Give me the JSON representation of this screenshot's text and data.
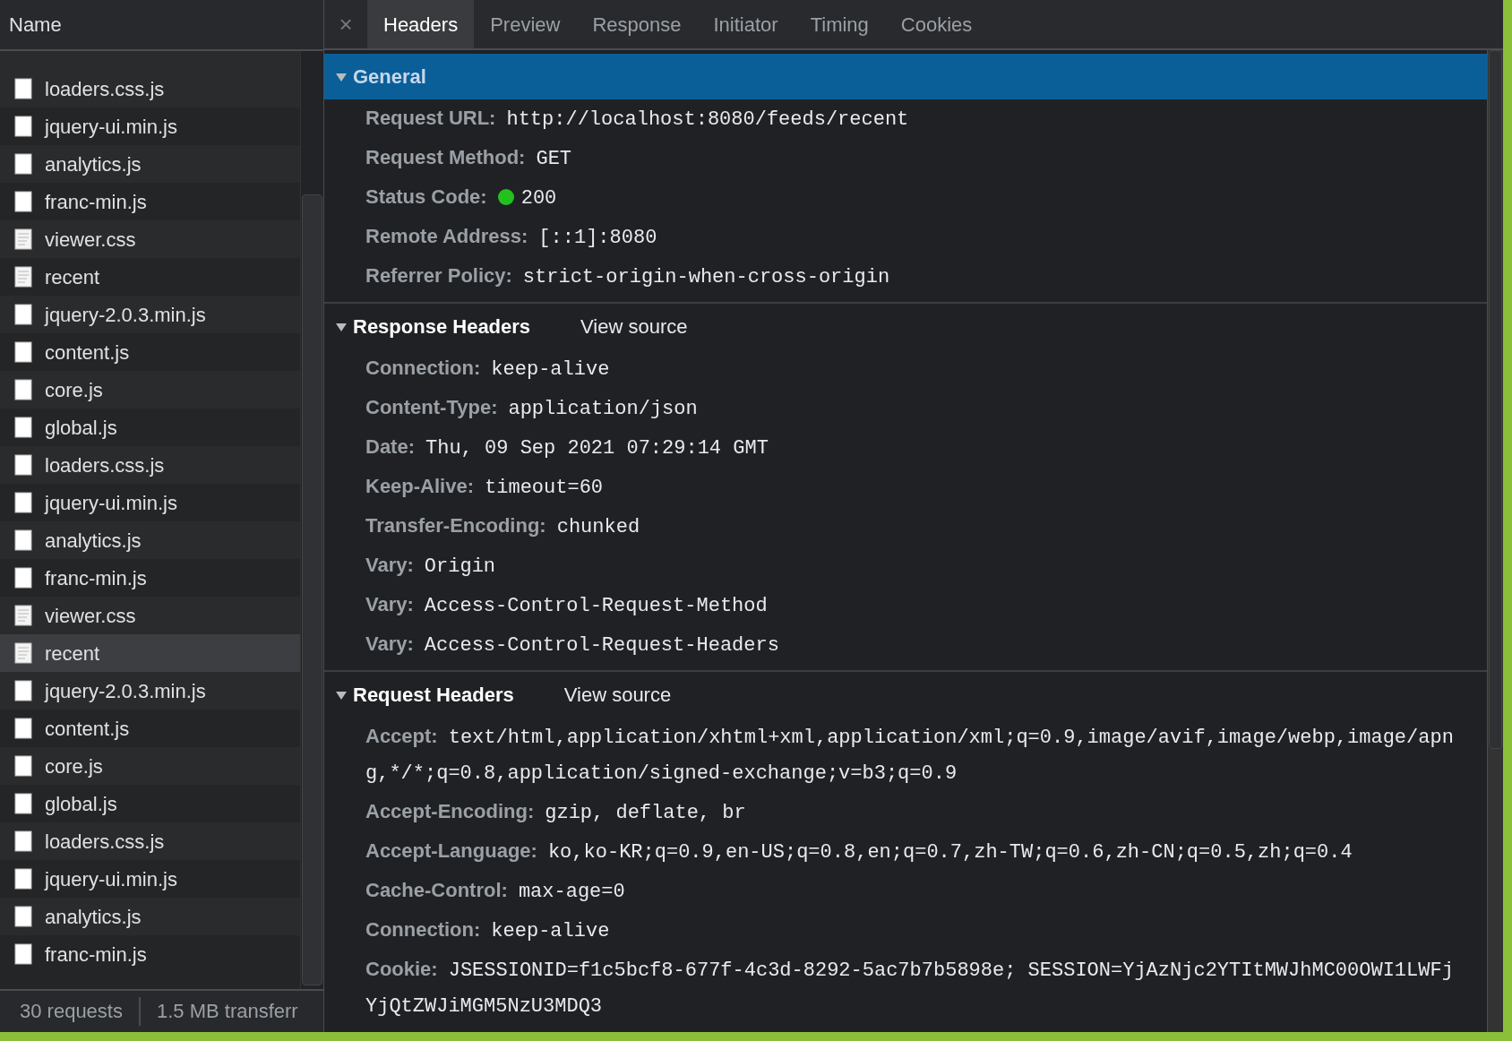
{
  "request_list": {
    "column": "Name",
    "rows": [
      {
        "name": "loaders.css.js",
        "kind": "script",
        "selected": false
      },
      {
        "name": "jquery-ui.min.js",
        "kind": "script",
        "selected": false
      },
      {
        "name": "analytics.js",
        "kind": "script",
        "selected": false
      },
      {
        "name": "franc-min.js",
        "kind": "script",
        "selected": false
      },
      {
        "name": "viewer.css",
        "kind": "text",
        "selected": false
      },
      {
        "name": "recent",
        "kind": "text",
        "selected": false
      },
      {
        "name": "jquery-2.0.3.min.js",
        "kind": "script",
        "selected": false
      },
      {
        "name": "content.js",
        "kind": "script",
        "selected": false
      },
      {
        "name": "core.js",
        "kind": "script",
        "selected": false
      },
      {
        "name": "global.js",
        "kind": "script",
        "selected": false
      },
      {
        "name": "loaders.css.js",
        "kind": "script",
        "selected": false
      },
      {
        "name": "jquery-ui.min.js",
        "kind": "script",
        "selected": false
      },
      {
        "name": "analytics.js",
        "kind": "script",
        "selected": false
      },
      {
        "name": "franc-min.js",
        "kind": "script",
        "selected": false
      },
      {
        "name": "viewer.css",
        "kind": "text",
        "selected": false
      },
      {
        "name": "recent",
        "kind": "text",
        "selected": true
      },
      {
        "name": "jquery-2.0.3.min.js",
        "kind": "script",
        "selected": false
      },
      {
        "name": "content.js",
        "kind": "script",
        "selected": false
      },
      {
        "name": "core.js",
        "kind": "script",
        "selected": false
      },
      {
        "name": "global.js",
        "kind": "script",
        "selected": false
      },
      {
        "name": "loaders.css.js",
        "kind": "script",
        "selected": false
      },
      {
        "name": "jquery-ui.min.js",
        "kind": "script",
        "selected": false
      },
      {
        "name": "analytics.js",
        "kind": "script",
        "selected": false
      },
      {
        "name": "franc-min.js",
        "kind": "script",
        "selected": false
      }
    ]
  },
  "status_bar": [
    "30 requests",
    "1.5 MB transferr"
  ],
  "close_glyph": "×",
  "tabs": [
    {
      "label": "Headers",
      "selected": true
    },
    {
      "label": "Preview",
      "selected": false
    },
    {
      "label": "Response",
      "selected": false
    },
    {
      "label": "Initiator",
      "selected": false
    },
    {
      "label": "Timing",
      "selected": false
    },
    {
      "label": "Cookies",
      "selected": false
    }
  ],
  "sections": [
    {
      "title": "General",
      "expanded": true,
      "selected": true,
      "headers": [
        {
          "kind": "plain",
          "name": "Request URL:",
          "value": "http://localhost:8080/feeds/recent"
        },
        {
          "kind": "plain",
          "name": "Request Method:",
          "value": "GET"
        },
        {
          "kind": "status",
          "name": "Status Code:",
          "value": "200",
          "color": "#22c11e"
        },
        {
          "kind": "plain",
          "name": "Remote Address:",
          "value": "[::1]:8080"
        },
        {
          "kind": "plain",
          "name": "Referrer Policy:",
          "value": "strict-origin-when-cross-origin"
        }
      ]
    },
    {
      "title": "Response Headers",
      "expanded": true,
      "selected": false,
      "link": "View source",
      "headers": [
        {
          "kind": "plain",
          "name": "Connection:",
          "value": "keep-alive"
        },
        {
          "kind": "plain",
          "name": "Content-Type:",
          "value": "application/json"
        },
        {
          "kind": "plain",
          "name": "Date:",
          "value": "Thu, 09 Sep 2021 07:29:14 GMT"
        },
        {
          "kind": "plain",
          "name": "Keep-Alive:",
          "value": "timeout=60"
        },
        {
          "kind": "plain",
          "name": "Transfer-Encoding:",
          "value": "chunked"
        },
        {
          "kind": "plain",
          "name": "Vary:",
          "value": "Origin"
        },
        {
          "kind": "plain",
          "name": "Vary:",
          "value": "Access-Control-Request-Method"
        },
        {
          "kind": "plain",
          "name": "Vary:",
          "value": "Access-Control-Request-Headers"
        }
      ]
    },
    {
      "title": "Request Headers",
      "expanded": true,
      "selected": false,
      "link": "View source",
      "headers": [
        {
          "kind": "plain",
          "name": "Accept:",
          "value": "text/html,application/xhtml+xml,application/xml;q=0.9,image/avif,image/webp,image/apng,*/*;q=0.8,application/signed-exchange;v=b3;q=0.9"
        },
        {
          "kind": "plain",
          "name": "Accept-Encoding:",
          "value": "gzip, deflate, br"
        },
        {
          "kind": "plain",
          "name": "Accept-Language:",
          "value": "ko,ko-KR;q=0.9,en-US;q=0.8,en;q=0.7,zh-TW;q=0.6,zh-CN;q=0.5,zh;q=0.4"
        },
        {
          "kind": "plain",
          "name": "Cache-Control:",
          "value": "max-age=0"
        },
        {
          "kind": "plain",
          "name": "Connection:",
          "value": "keep-alive"
        },
        {
          "kind": "plain",
          "name": "Cookie:",
          "value": "JSESSIONID=f1c5bcf8-677f-4c3d-8292-5ac7b7b5898e; SESSION=YjAzNjc2YTItMWJhMC00OWI1LWFjYjQtZWJiMGM5NzU3MDQ3"
        }
      ]
    }
  ]
}
